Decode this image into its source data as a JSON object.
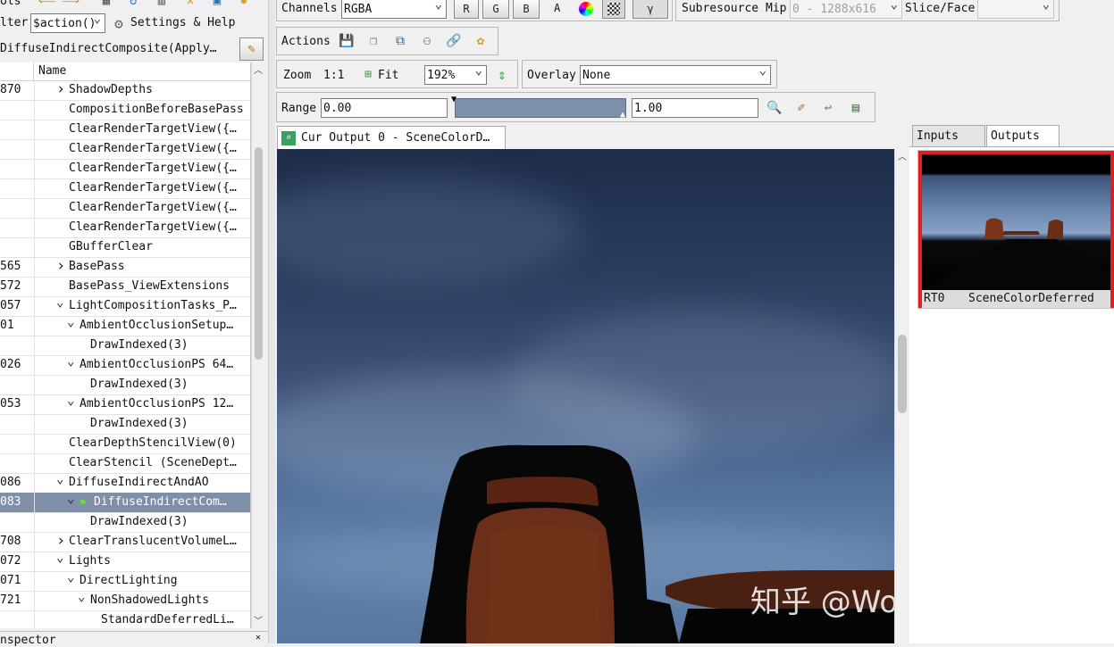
{
  "left_toolbar": {
    "tools_label": "ols",
    "filter_label": "lter",
    "filter_value": "$action()",
    "settings_label": "Settings & Help"
  },
  "marker_title": "DiffuseIndirectComposite(Apply…",
  "tree": {
    "col_eid": "",
    "col_name": "Name",
    "rows": [
      {
        "eid": "870",
        "name": "ShadowDepths",
        "indent": 0,
        "chev": ">"
      },
      {
        "eid": "",
        "name": "CompositionBeforeBasePass",
        "indent": 0,
        "chev": ""
      },
      {
        "eid": "",
        "name": "ClearRenderTargetView({…",
        "indent": 0,
        "chev": ""
      },
      {
        "eid": "",
        "name": "ClearRenderTargetView({…",
        "indent": 0,
        "chev": ""
      },
      {
        "eid": "",
        "name": "ClearRenderTargetView({…",
        "indent": 0,
        "chev": ""
      },
      {
        "eid": "",
        "name": "ClearRenderTargetView({…",
        "indent": 0,
        "chev": ""
      },
      {
        "eid": "",
        "name": "ClearRenderTargetView({…",
        "indent": 0,
        "chev": ""
      },
      {
        "eid": "",
        "name": "ClearRenderTargetView({…",
        "indent": 0,
        "chev": ""
      },
      {
        "eid": "",
        "name": "GBufferClear",
        "indent": 0,
        "chev": ""
      },
      {
        "eid": "565",
        "name": "BasePass",
        "indent": 0,
        "chev": ">"
      },
      {
        "eid": "572",
        "name": "BasePass_ViewExtensions",
        "indent": 0,
        "chev": ""
      },
      {
        "eid": "057",
        "name": "LightCompositionTasks_P…",
        "indent": 0,
        "chev": "v"
      },
      {
        "eid": "01",
        "name": "AmbientOcclusionSetup…",
        "indent": 1,
        "chev": "v"
      },
      {
        "eid": "",
        "name": "DrawIndexed(3)",
        "indent": 2,
        "chev": ""
      },
      {
        "eid": "026",
        "name": "AmbientOcclusionPS 64…",
        "indent": 1,
        "chev": "v"
      },
      {
        "eid": "",
        "name": "DrawIndexed(3)",
        "indent": 2,
        "chev": ""
      },
      {
        "eid": "053",
        "name": "AmbientOcclusionPS 12…",
        "indent": 1,
        "chev": "v"
      },
      {
        "eid": "",
        "name": "DrawIndexed(3)",
        "indent": 2,
        "chev": ""
      },
      {
        "eid": "",
        "name": "ClearDepthStencilView(0)",
        "indent": 0,
        "chev": ""
      },
      {
        "eid": "",
        "name": "ClearStencil (SceneDept…",
        "indent": 0,
        "chev": ""
      },
      {
        "eid": "086",
        "name": "DiffuseIndirectAndAO",
        "indent": 0,
        "chev": "v"
      },
      {
        "eid": "083",
        "name": "DiffuseIndirectCom…",
        "indent": 1,
        "chev": "v",
        "selected": true,
        "flag": true
      },
      {
        "eid": "",
        "name": "DrawIndexed(3)",
        "indent": 2,
        "chev": ""
      },
      {
        "eid": "708",
        "name": "ClearTranslucentVolumeL…",
        "indent": 0,
        "chev": ">"
      },
      {
        "eid": "072",
        "name": "Lights",
        "indent": 0,
        "chev": "v"
      },
      {
        "eid": "071",
        "name": "DirectLighting",
        "indent": 1,
        "chev": "v"
      },
      {
        "eid": "721",
        "name": "NonShadowedLights",
        "indent": 2,
        "chev": "v"
      },
      {
        "eid": "",
        "name": "StandardDeferredLi…",
        "indent": 3,
        "chev": ""
      }
    ]
  },
  "bottom_panel_label": "nspector",
  "texture_toolbar": {
    "channels_label": "Channels",
    "channels_value": "RGBA",
    "r": "R",
    "g": "G",
    "b": "B",
    "a": "A",
    "gamma": "γ",
    "subresource_label": "Subresource",
    "mip_label": "Mip",
    "mip_value": "0 - 1288x616",
    "slice_label": "Slice/Face",
    "slice_value": "",
    "actions_label": "Actions",
    "zoom_label": "Zoom",
    "zoom_1to1": "1:1",
    "fit_label": "Fit",
    "zoom_value": "192%",
    "overlay_label": "Overlay",
    "overlay_value": "None",
    "range_label": "Range",
    "range_min": "0.00",
    "range_max": "1.00"
  },
  "viewer_tab": "Cur Output 0 - SceneColorD…",
  "thumbs": {
    "tab_inputs": "Inputs",
    "tab_outputs": "Outputs",
    "slot": "RT0",
    "name": "SceneColorDeferred"
  },
  "watermark": "知乎 @Wonderful笔记",
  "colors": {
    "selected_row": "#7f8fa8",
    "thumb_border": "#e02020",
    "range_bar": "#7d8fa9"
  }
}
